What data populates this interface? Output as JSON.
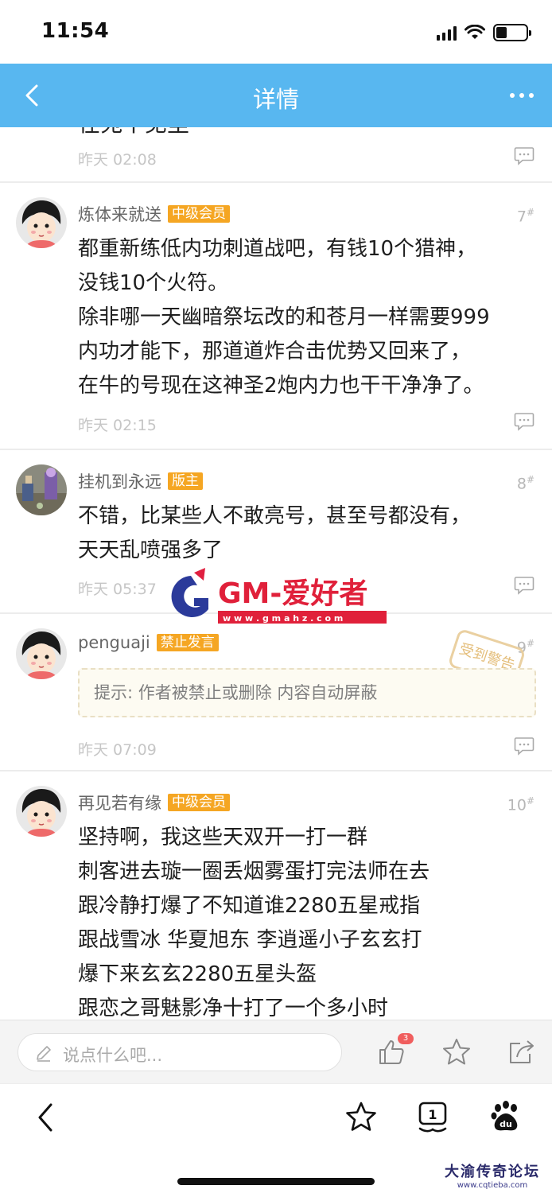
{
  "status_bar": {
    "time": "11:54"
  },
  "nav": {
    "title": "详情"
  },
  "partial_post": {
    "text": "在苑不见里",
    "time": "昨天 02:08"
  },
  "posts": [
    {
      "author": "炼体来就送",
      "badge": "中级会员",
      "floor": "7",
      "text": "都重新练低内功刺道战吧，有钱10个猎神，\n没钱10个火符。\n除非哪一天幽暗祭坛改的和苍月一样需要999\n内功才能下，那道道炸合击优势又回来了，\n在牛的号现在这神圣2炮内力也干干净净了。",
      "time": "昨天 02:15"
    },
    {
      "author": "挂机到永远",
      "badge": "版主",
      "floor": "8",
      "text": "不错，比某些人不敢亮号，甚至号都没有，\n天天乱喷强多了",
      "time": "昨天 05:37"
    },
    {
      "author": "penguaji",
      "badge": "禁止发言",
      "floor": "9",
      "notice": "提示: 作者被禁止或删除 内容自动屏蔽",
      "stamp": "受到警告",
      "time": "昨天 07:09"
    },
    {
      "author": "再见若有缘",
      "badge": "中级会员",
      "floor": "10",
      "text": "坚持啊，我这些天双开一打一群\n刺客进去璇一圈丢烟雾蛋打完法师在去\n跟冷静打爆了不知道谁2280五星戒指\n跟战雪冰 华夏旭东 李逍遥小子玄玄打\n爆下来玄玄2280五星头盔\n跟恋之哥魅影净十打了一个多小时"
    }
  ],
  "watermark": {
    "text": "GM-爱好者",
    "url": "w w w . g m a h z . c o m"
  },
  "reply_bar": {
    "placeholder": "说点什么吧...",
    "like_count": "3"
  },
  "site_logo": {
    "name": "大渝传奇论坛",
    "url": "www.cqtieba.com"
  },
  "colors": {
    "nav_blue": "#58b7f0",
    "badge_orange": "#f5a623",
    "like_red": "#f05e5e"
  }
}
